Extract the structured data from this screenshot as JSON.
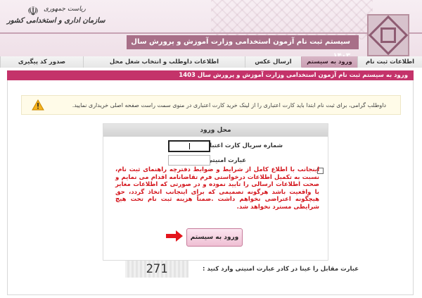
{
  "header": {
    "title": "سیستم ثبت نام آزمون استخدامی وزارت آموزش و پرورش سال ۱۴۰۳",
    "org_line1": "ریاست جمهوری",
    "org_line2": "سازمان اداری و استخدامی کشور",
    "emblem_icon": "iran-emblem-icon"
  },
  "nav": {
    "tabs": [
      {
        "label": "اطلاعات ثبت نام"
      },
      {
        "label": "ورود به سیستم"
      },
      {
        "label": "ارسال عکس"
      },
      {
        "label": "اطلاعات داوطلب و انتخاب شغل محل"
      },
      {
        "label": "صدور کد پیگیری"
      }
    ],
    "active_index": 1
  },
  "breadcrumb": "ورود به سیستم ثبت نام آزمون استخدامی وزارت آموزش و پرورش سال 1403",
  "notice": {
    "text": "داوطلب گرامی، برای ثبت نام ابتدا باید کارت اعتباری را از لینک خرید کارت اعتباری در منوی سمت راست صفحه اصلی خریداری نمایید.",
    "icon": "warning-icon"
  },
  "login": {
    "heading": "محل ورود",
    "serial_label": "شماره سریال کارت اعتباری",
    "password_label": "عبارت امنیتی",
    "terms_text": "اینجانب با اطلاع کامل از شرایط و ضوابط دفترچه راهنمای ثبت نام، نسبت به تکمیل اطلاعات درخواستی فرم تقاضانامه اقدام می نمایم و صحت اطلاعات ارسالی را تایید نموده و در صورتی که اطلاعات مغایر با واقعیت باشد هرگونه تصمیمی که برای اینجانب اتخاذ گردد، حق هیچگونه اعتراضی نخواهم داشت .ضمناً هزینه ثبت نام تحت هیچ شرایطی مسترد نخواهد شد.",
    "submit_label": "ورود به سیستم"
  },
  "captcha": {
    "label": "عبارت مقابل را عینا در کادر عبارت امنیتی وارد کنید :",
    "value": "271"
  },
  "colors": {
    "brand": "#a86f88",
    "breadcrumb_bg": "#c4336a",
    "terms_text": "#d4151c"
  }
}
